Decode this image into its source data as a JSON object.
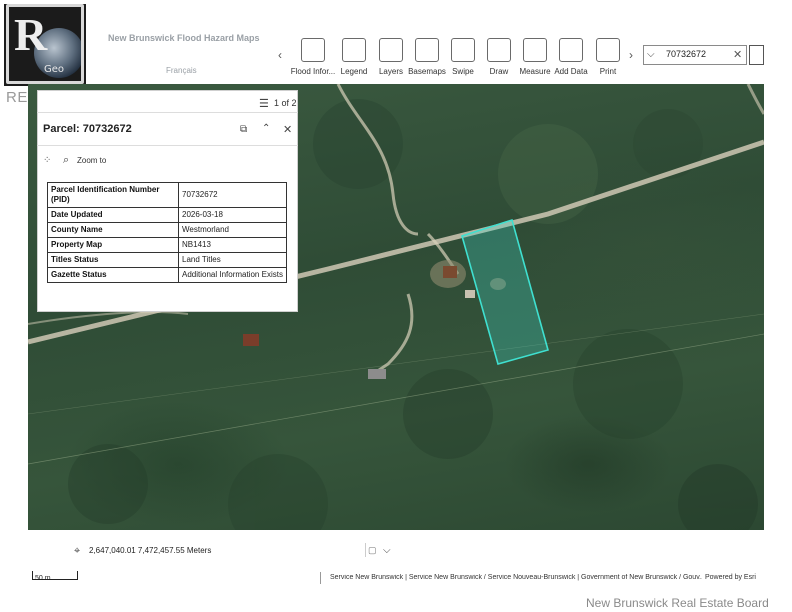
{
  "branding": {
    "realtor_word": "REALTOR",
    "realtor_letter": "R",
    "geo_badge": "Geo"
  },
  "header": {
    "app_title": "New Brunswick Flood Hazard Maps",
    "language_link": "Français"
  },
  "toolbar": {
    "items": [
      {
        "label": "Flood Infor..."
      },
      {
        "label": "Legend"
      },
      {
        "label": "Layers"
      },
      {
        "label": "Basemaps"
      },
      {
        "label": "Swipe"
      },
      {
        "label": "Draw"
      },
      {
        "label": "Measure"
      },
      {
        "label": "Add Data"
      },
      {
        "label": "Print"
      }
    ]
  },
  "search": {
    "value": "70732672",
    "clear_glyph": "✕"
  },
  "popup": {
    "pagination": "1 of 2",
    "title": "Parcel: 70732672",
    "zoom_label": "Zoom to",
    "attributes": [
      {
        "key": "Parcel Identification Number (PID)",
        "value": "70732672"
      },
      {
        "key": "Date Updated",
        "value": "2026-03-18"
      },
      {
        "key": "County Name",
        "value": "Westmorland"
      },
      {
        "key": "Property Map",
        "value": "NB1413"
      },
      {
        "key": "Titles Status",
        "value": "Land Titles"
      },
      {
        "key": "Gazette Status",
        "value": "Additional Information Exists"
      }
    ]
  },
  "footer": {
    "coordinates": "2,647,040.01 7,472,457.55 Meters",
    "scale": "50 m",
    "credits": "Service New Brunswick | Service New Brunswick / Service Nouveau-Brunswick | Government of New Brunswick / Gouv...",
    "powered_by": "Powered by Esri"
  },
  "watermark": "New Brunswick Real Estate Board",
  "colors": {
    "parcel_outline": "#3fe0d0",
    "map_forest": "#34533a",
    "road": "#c9c3b2"
  },
  "icons": {
    "pagination": "list-icon",
    "dock": "dock-icon",
    "collapse": "chevron-up-icon",
    "close": "close-icon",
    "select": "select-features-icon",
    "zoom": "zoom-icon",
    "coordinate": "crosshair-icon"
  }
}
